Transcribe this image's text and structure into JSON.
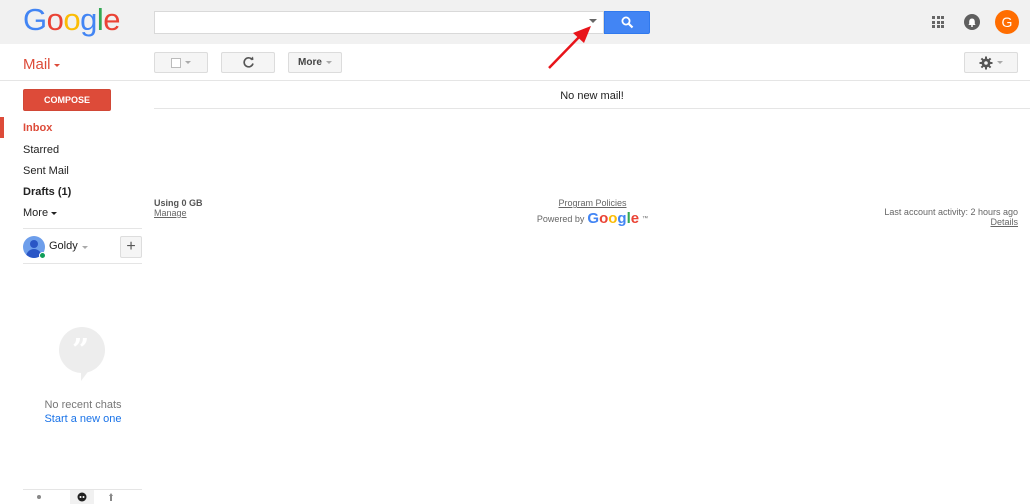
{
  "header": {
    "logo_letters": [
      "G",
      "o",
      "o",
      "g",
      "l",
      "e"
    ],
    "search_value": "",
    "search_placeholder": "",
    "search_options_icon": "caret-down-icon",
    "search_button_icon": "search-icon",
    "apps_icon": "apps-grid-icon",
    "notifications_icon": "bell-icon",
    "account_initial": "G",
    "account_color": "#ff6d00"
  },
  "toolbar": {
    "app_label": "Mail",
    "select_icon": "checkbox-icon",
    "refresh_icon": "refresh-icon",
    "more_label": "More",
    "settings_icon": "gear-icon"
  },
  "sidebar": {
    "compose_label": "COMPOSE",
    "items": [
      {
        "label": "Inbox",
        "active": true
      },
      {
        "label": "Starred"
      },
      {
        "label": "Sent Mail"
      },
      {
        "label": "Drafts (1)",
        "bold": true
      },
      {
        "label": "More"
      }
    ],
    "user": {
      "name": "Goldy",
      "status": "online"
    },
    "add_chat_label": "+",
    "chat": {
      "empty_text": "No recent chats",
      "start_link": "Start a new one"
    }
  },
  "main": {
    "status_message": "No new mail!",
    "footer": {
      "usage": "Using 0 GB",
      "manage_link": "Manage",
      "policies_link": "Program Policies",
      "powered_by": "Powered by",
      "powered_logo": [
        "G",
        "o",
        "o",
        "g",
        "l",
        "e"
      ],
      "tm": "™",
      "last_activity": "Last account activity: 2 hours ago",
      "details_link": "Details"
    }
  },
  "colors": {
    "brand_red": "#dd4b39",
    "search_blue": "#4285f4",
    "link_blue": "#1a73e8",
    "annotation_arrow": "#e8141a"
  }
}
